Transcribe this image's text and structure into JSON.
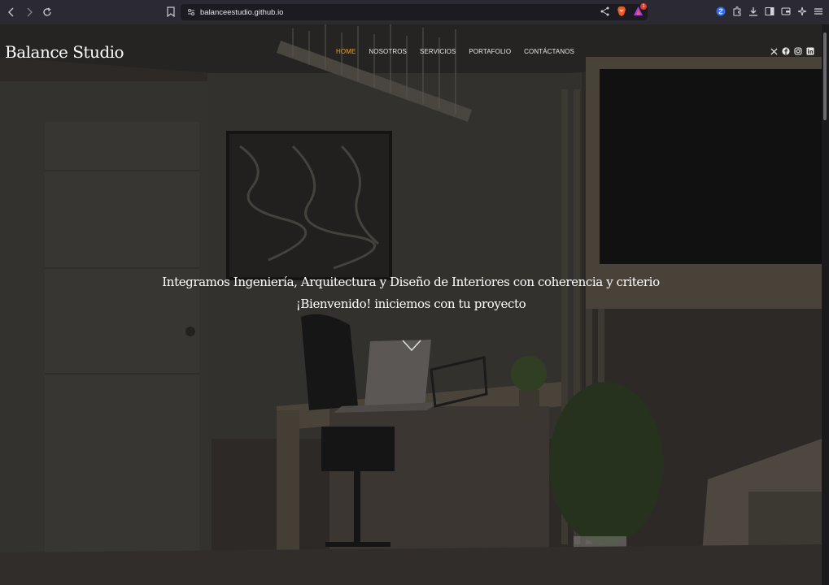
{
  "browser": {
    "url": "balanceestudio.github.io",
    "rewards_badge": "1"
  },
  "site": {
    "brand": "Balance Studio",
    "nav": [
      {
        "label": "HOME",
        "active": true
      },
      {
        "label": "NOSOTROS",
        "active": false
      },
      {
        "label": "SERVICIOS",
        "active": false
      },
      {
        "label": "PORTAFOLIO",
        "active": false
      },
      {
        "label": "CONTÁCTANOS",
        "active": false
      }
    ],
    "social_icons": [
      "x-icon",
      "facebook-icon",
      "instagram-icon",
      "linkedin-icon"
    ],
    "accent_color": "#e6a429"
  },
  "hero": {
    "line1": "Integramos Ingeniería, Arquitectura y Diseño de Interiores con coherencia y criterio",
    "line2": "¡Bienvenido! iniciemos con tu proyecto",
    "scroll_icon": "chevron-down-icon"
  }
}
